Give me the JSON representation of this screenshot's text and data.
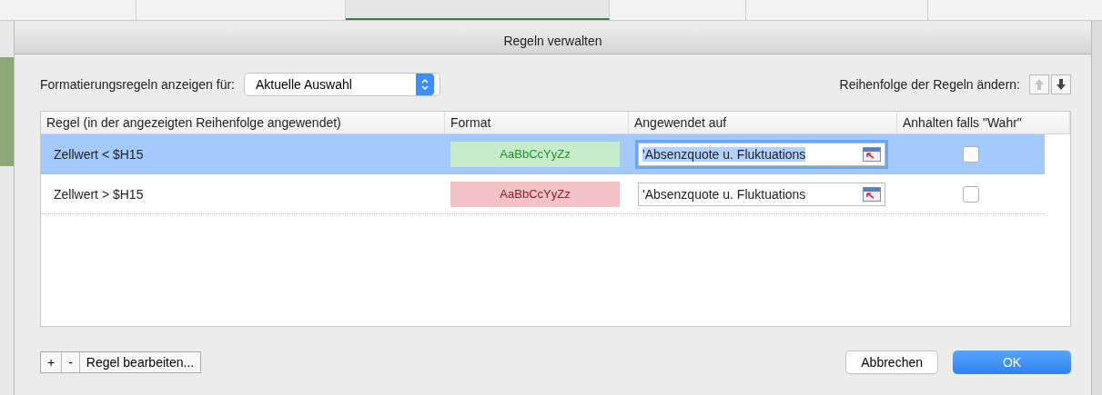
{
  "window": {
    "title": "Regeln verwalten"
  },
  "filter": {
    "label": "Formatierungsregeln anzeigen für:",
    "value": "Aktuelle Auswahl"
  },
  "order": {
    "label": "Reihenfolge der Regeln ändern:",
    "up_disabled": true,
    "down_disabled": false
  },
  "table": {
    "columns": [
      "Regel (in der angezeigten Reihenfolge angewendet)",
      "Format",
      "Angewendet auf",
      "Anhalten falls \"Wahr\""
    ],
    "rows": [
      {
        "rule": "Zellwert < $H15",
        "format": "AaBbCcYyZz",
        "color": "#c6eccb",
        "applies_to": "'Absenzquote u. Fluktuations",
        "stop": false,
        "selected": true
      },
      {
        "rule": "Zellwert > $H15",
        "format": "AaBbCcYyZz",
        "color": "#f4c3c8",
        "applies_to": "'Absenzquote u. Fluktuations",
        "stop": false,
        "selected": false
      }
    ]
  },
  "footer": {
    "add": "+",
    "remove": "-",
    "edit": "Regel bearbeiten...",
    "cancel": "Abbrechen",
    "ok": "OK"
  }
}
